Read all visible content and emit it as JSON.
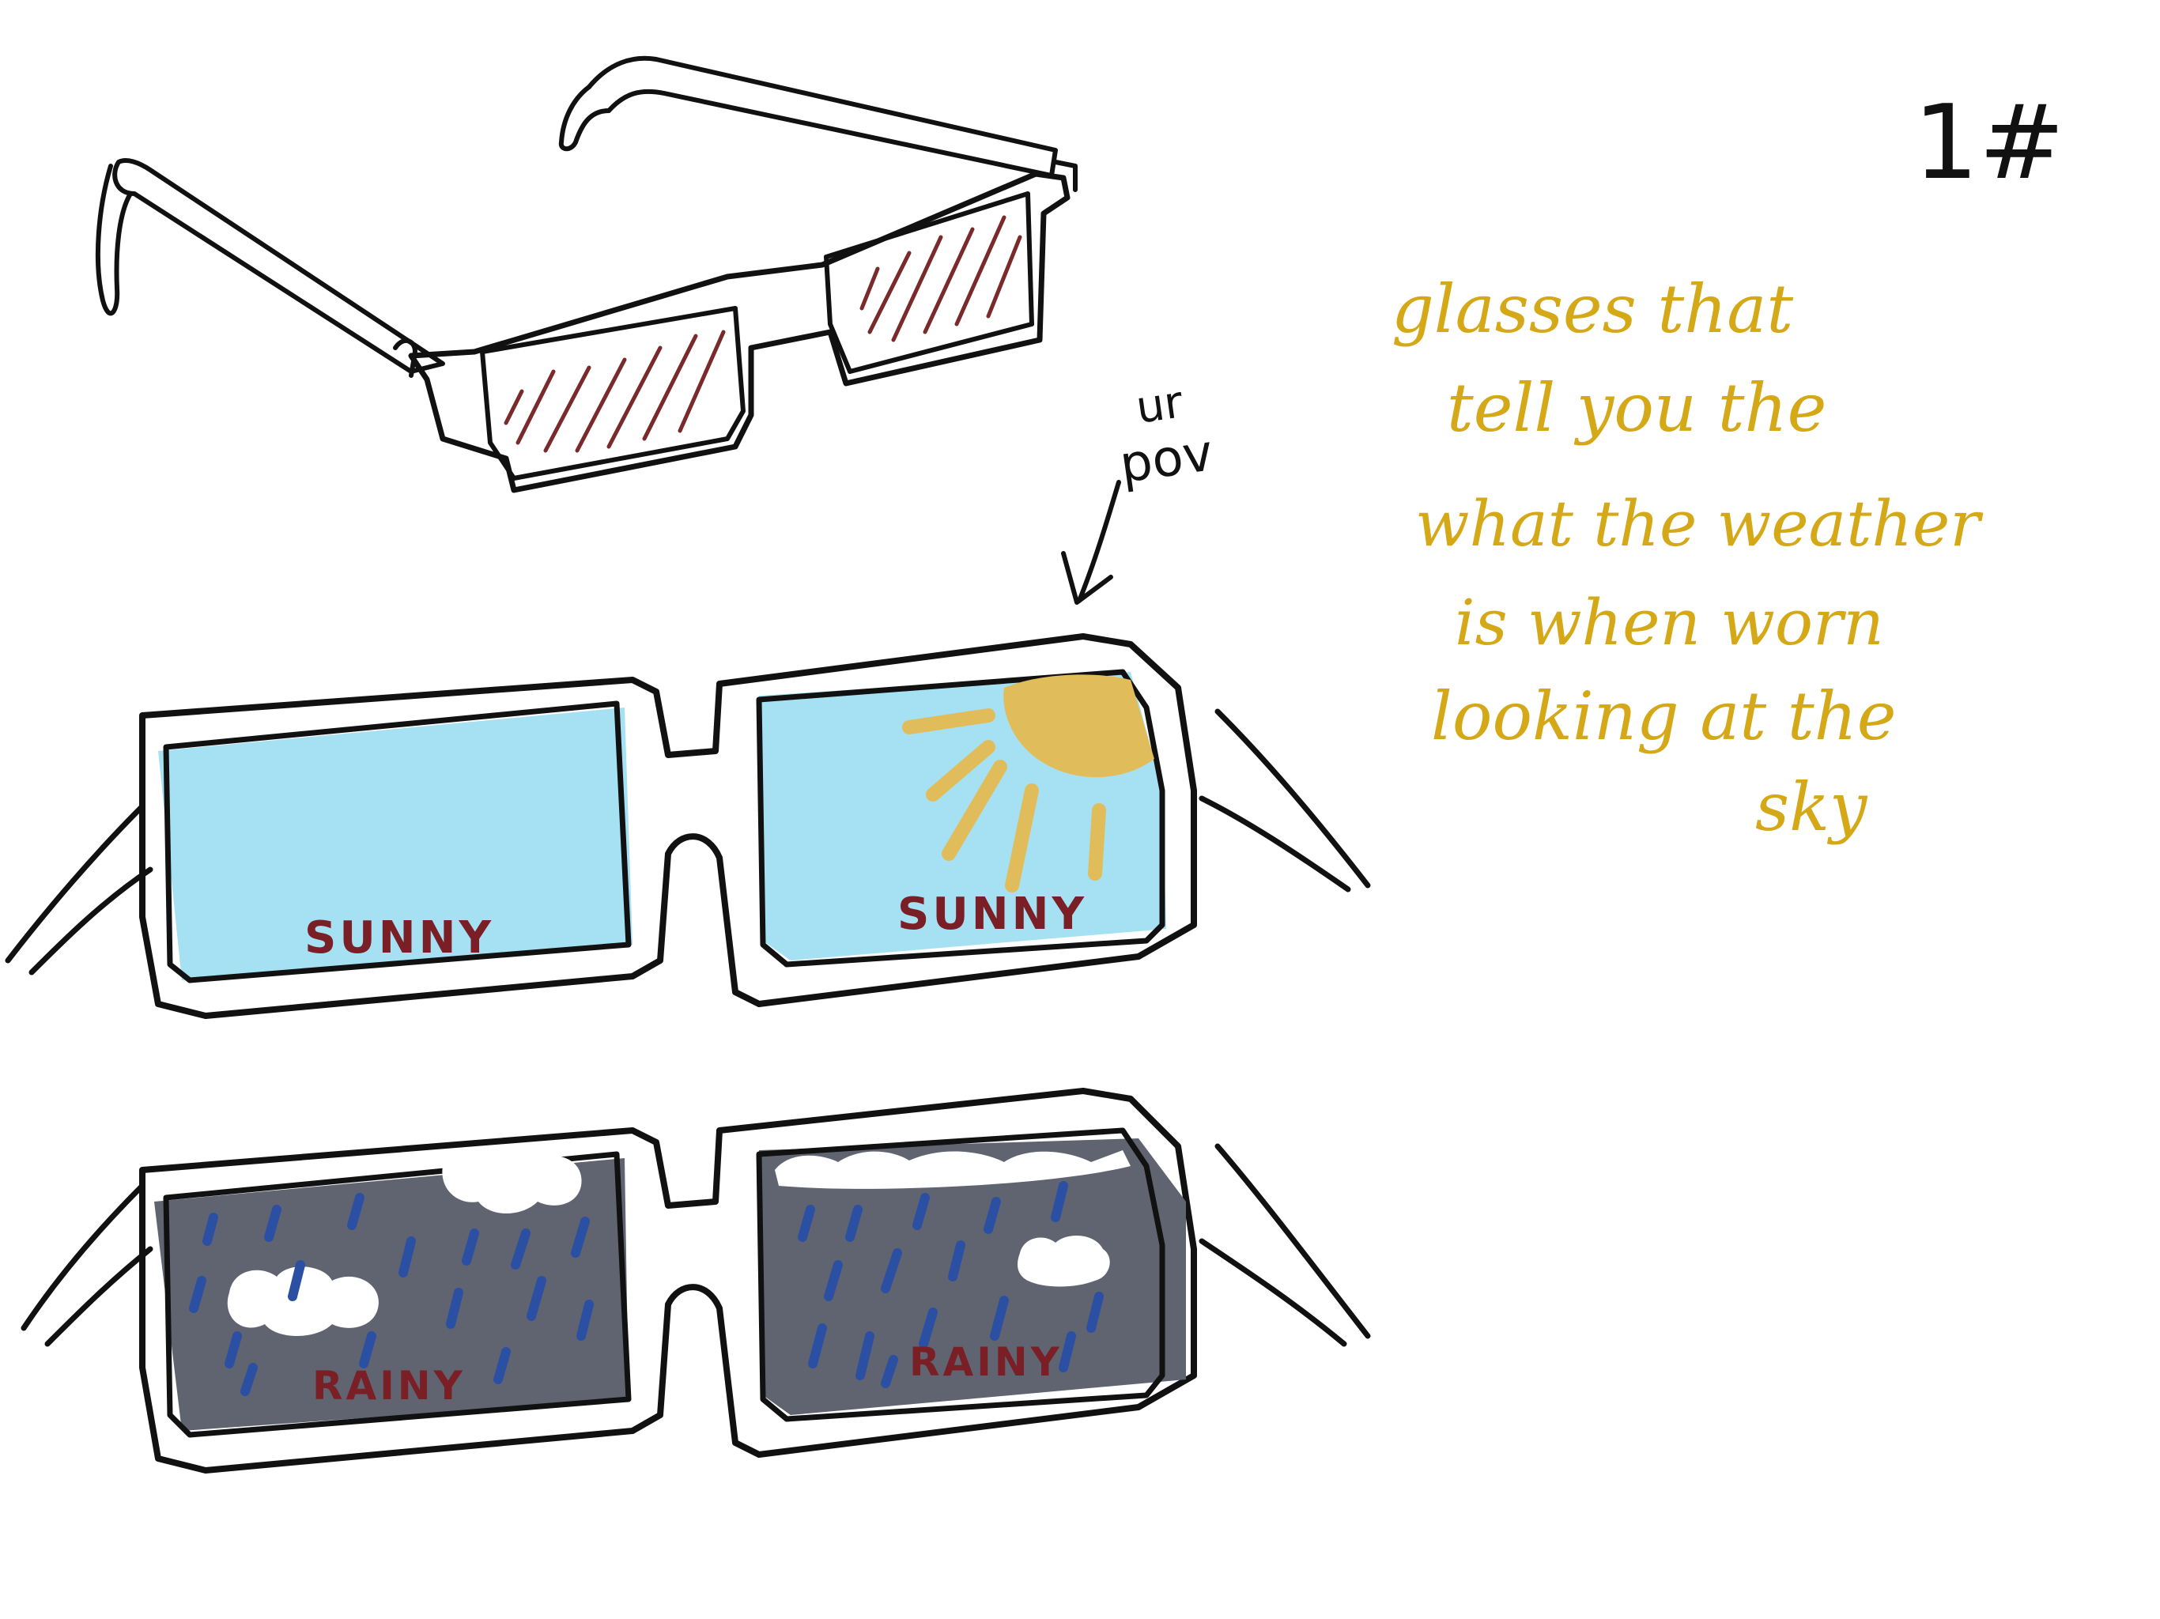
{
  "page_number": "1#",
  "pov_label": [
    "ur",
    "pov"
  ],
  "description_lines": [
    "glasses that",
    "tell you the",
    "what the weather",
    "is when worn",
    "looking at the",
    "sky"
  ],
  "sunny_pair": {
    "left_label": "SUNNY",
    "right_label": "SUNNY"
  },
  "rainy_pair": {
    "left_label": "RAINY",
    "right_label": "RAINY"
  },
  "colors": {
    "ink": "#111111",
    "note_text": "#d4a817",
    "lens_label": "#7a1f25",
    "sunny_lens": "#a6e1f3",
    "sun": "#e0bd5a",
    "rainy_lens": "#5f6470",
    "rain": "#2b4fa3",
    "cloud": "#ffffff",
    "tint_stroke": "#7a2a2a"
  },
  "icons": [
    "glasses-sketch-icon",
    "sun-icon",
    "cloud-icon",
    "raindrop-icon",
    "arrow-down-left-icon"
  ]
}
